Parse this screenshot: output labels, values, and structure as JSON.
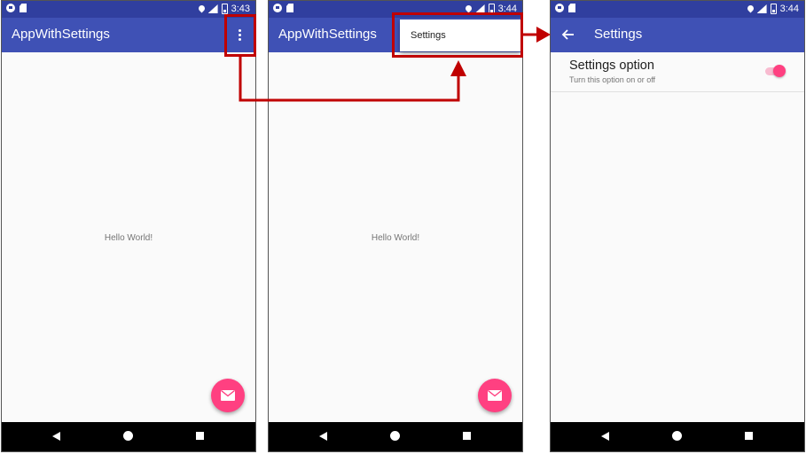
{
  "colors": {
    "primary": "#3f51b5",
    "primary_dark": "#303f9f",
    "accent": "#ff4081",
    "highlight": "#c00000"
  },
  "screens": [
    {
      "status_time": "3:43",
      "app_title": "AppWithSettings",
      "overflow_icon": "more-vert-icon",
      "body_text": "Hello World!",
      "fab_icon": "email-icon"
    },
    {
      "status_time": "3:44",
      "app_title": "AppWithSettings",
      "menu_item": "Settings",
      "body_text": "Hello World!",
      "fab_icon": "email-icon"
    },
    {
      "status_time": "3:44",
      "title": "Settings",
      "back_icon": "arrow-back-icon",
      "preference": {
        "title": "Settings option",
        "summary": "Turn this option on or off",
        "enabled": true
      }
    }
  ],
  "status_icons": [
    "message-icon",
    "sd-card-icon",
    "location-icon",
    "lte-signal-icon",
    "battery-icon"
  ],
  "nav_icons": [
    "nav-back-icon",
    "nav-home-icon",
    "nav-recents-icon"
  ],
  "lte_label": "LTE"
}
